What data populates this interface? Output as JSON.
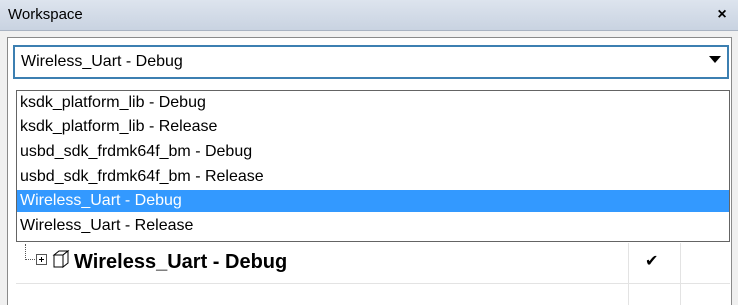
{
  "window": {
    "title": "Workspace",
    "close_symbol": "×"
  },
  "configuration_selector": {
    "selected": "Wireless_Uart - Debug",
    "options": [
      "ksdk_platform_lib - Debug",
      "ksdk_platform_lib - Release",
      "usbd_sdk_frdmk64f_bm - Debug",
      "usbd_sdk_frdmk64f_bm - Release",
      "Wireless_Uart - Debug",
      "Wireless_Uart - Release"
    ],
    "highlighted_option": "Wireless_Uart - Debug"
  },
  "tree": {
    "project_name": "Wireless_Uart - Debug",
    "project_icon": "project-cube-icon",
    "expander_icon": "plus-box-icon",
    "check_mark": "✔"
  },
  "colors": {
    "title_bar": "#c9d3e1",
    "selection": "#3399ff",
    "combo_border": "#3c7fb1"
  }
}
